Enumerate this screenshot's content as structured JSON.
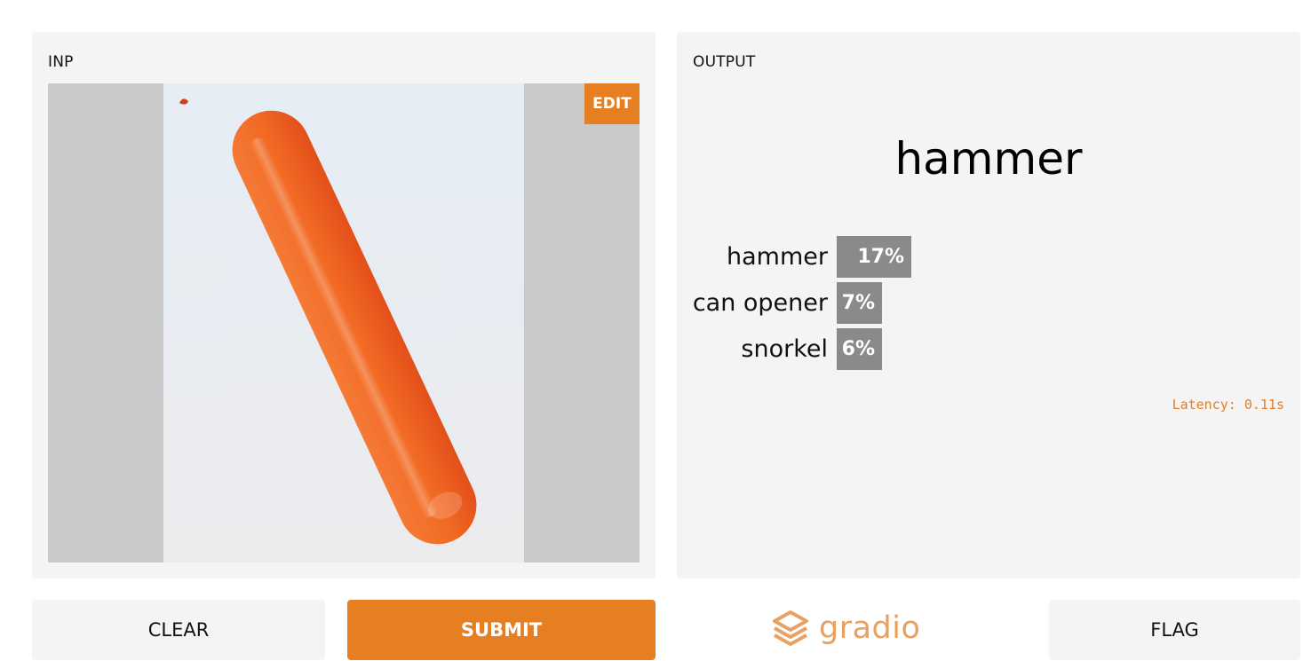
{
  "app": {
    "accent_color": "#e67e22",
    "panel_color": "#f4f4f4"
  },
  "input": {
    "label": "INP",
    "edit_label": "EDIT",
    "image_subject": "orange-balloon"
  },
  "output": {
    "label": "OUTPUT",
    "top_prediction": "hammer",
    "confidences": [
      {
        "label": "hammer",
        "percent_text": "17%",
        "value": 0.17
      },
      {
        "label": "can opener",
        "percent_text": "7%",
        "value": 0.07
      },
      {
        "label": "snorkel",
        "percent_text": "6%",
        "value": 0.06
      }
    ],
    "latency_text": "Latency: 0.11s"
  },
  "buttons": {
    "clear": "CLEAR",
    "submit": "SUBMIT",
    "flag": "FLAG"
  },
  "brand": {
    "name": "gradio",
    "icon": "gradio-logo-icon"
  }
}
